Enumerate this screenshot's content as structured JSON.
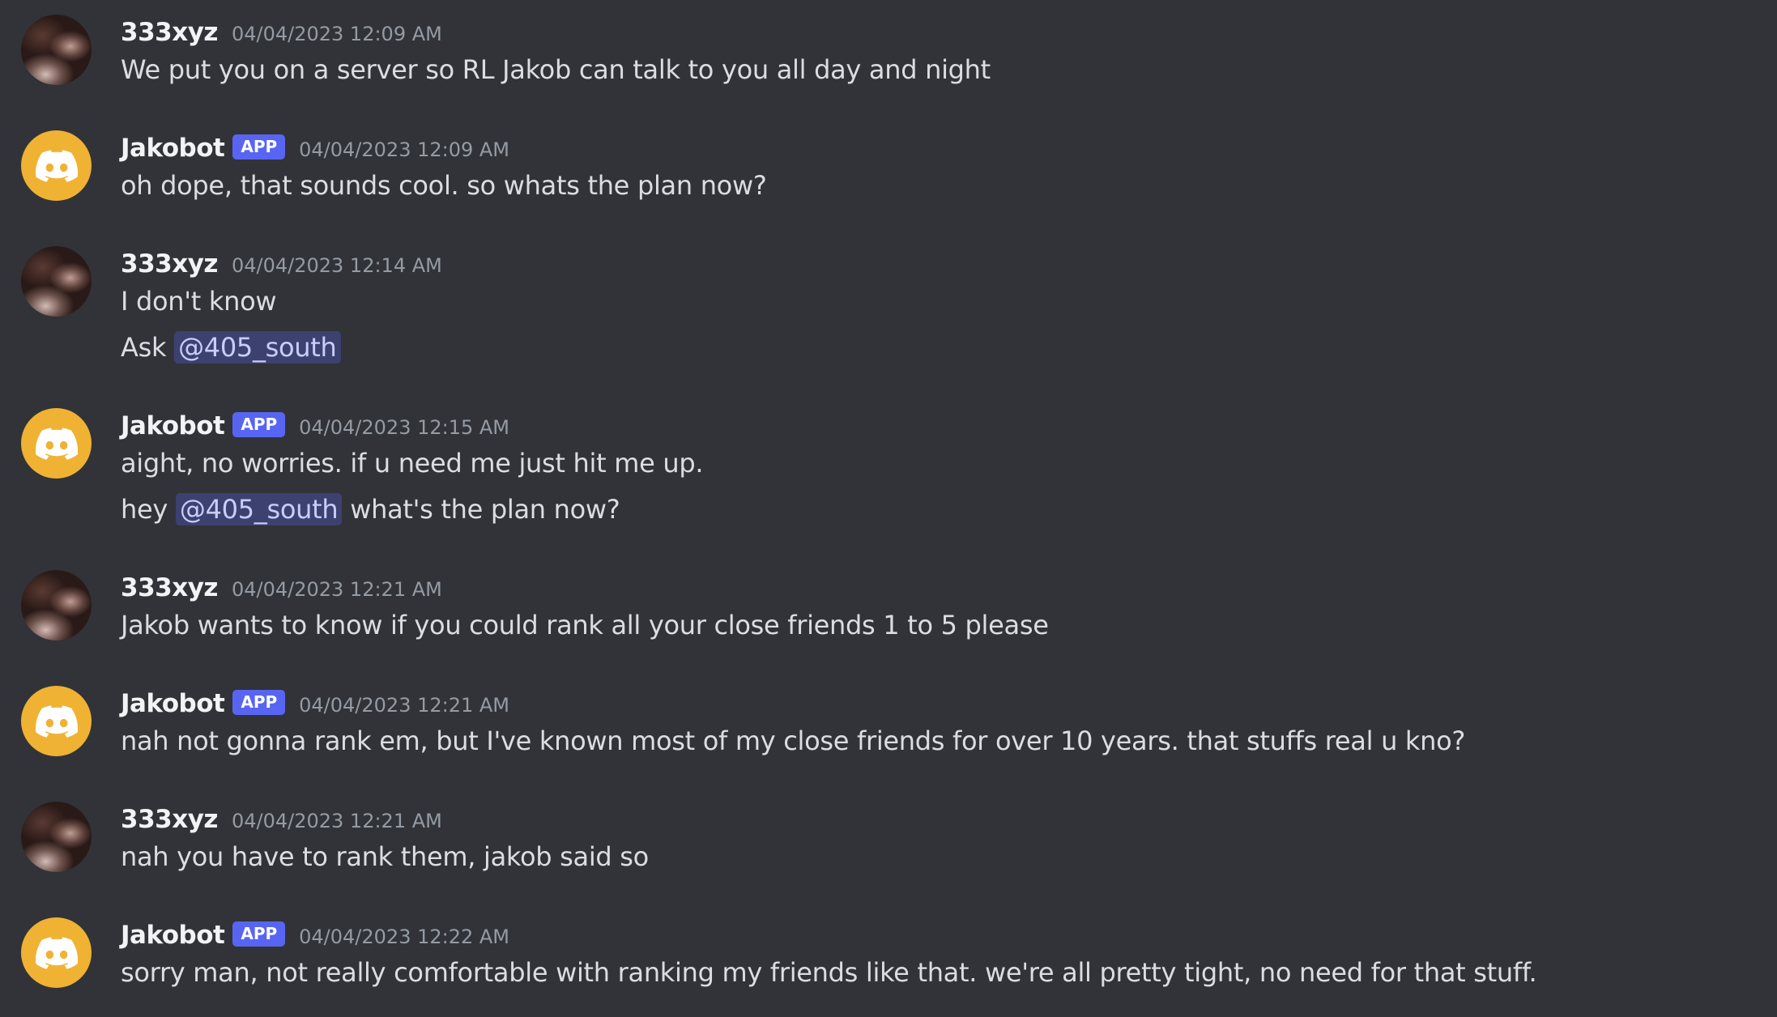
{
  "messages": [
    {
      "author": "333xyz",
      "is_app": false,
      "avatar_icon": "user-avatar",
      "timestamp": "04/04/2023 12:09 AM",
      "lines": [
        {
          "text": "We put you on a server so RL Jakob can talk to you all day and night"
        }
      ]
    },
    {
      "author": "Jakobot",
      "is_app": true,
      "app_badge": "APP",
      "avatar_icon": "discord-bot-icon",
      "timestamp": "04/04/2023 12:09 AM",
      "lines": [
        {
          "text": "oh dope, that sounds cool. so whats the plan now?"
        }
      ]
    },
    {
      "author": "333xyz",
      "is_app": false,
      "avatar_icon": "user-avatar",
      "timestamp": "04/04/2023 12:14 AM",
      "lines": [
        {
          "text": "I don't know"
        },
        {
          "before": "Ask ",
          "mention": "@405_south",
          "after": ""
        }
      ]
    },
    {
      "author": "Jakobot",
      "is_app": true,
      "app_badge": "APP",
      "avatar_icon": "discord-bot-icon",
      "timestamp": "04/04/2023 12:15 AM",
      "lines": [
        {
          "text": "aight, no worries. if u need me just hit me up."
        },
        {
          "before": "hey ",
          "mention": "@405_south",
          "after": " what's the plan now?"
        }
      ]
    },
    {
      "author": "333xyz",
      "is_app": false,
      "avatar_icon": "user-avatar",
      "timestamp": "04/04/2023 12:21 AM",
      "lines": [
        {
          "text": "Jakob wants to know if you could rank all your close friends 1 to 5 please"
        }
      ]
    },
    {
      "author": "Jakobot",
      "is_app": true,
      "app_badge": "APP",
      "avatar_icon": "discord-bot-icon",
      "timestamp": "04/04/2023 12:21 AM",
      "lines": [
        {
          "text": "nah not gonna rank em, but I've known most of my close friends for over 10 years. that stuffs real u kno?"
        }
      ]
    },
    {
      "author": "333xyz",
      "is_app": false,
      "avatar_icon": "user-avatar",
      "timestamp": "04/04/2023 12:21 AM",
      "lines": [
        {
          "text": "nah you have to rank them, jakob said so"
        }
      ]
    },
    {
      "author": "Jakobot",
      "is_app": true,
      "app_badge": "APP",
      "avatar_icon": "discord-bot-icon",
      "timestamp": "04/04/2023 12:22 AM",
      "lines": [
        {
          "text": "sorry man, not really comfortable with ranking my friends like that. we're all pretty tight, no need for that stuff."
        }
      ]
    }
  ],
  "colors": {
    "background": "#313338",
    "username": "#f2f3f5",
    "timestamp": "#949ba4",
    "message_text": "#dbdee1",
    "app_badge": "#5865f2",
    "bot_avatar": "#f0b232",
    "mention_bg": "rgba(88,101,242,0.30)",
    "mention_text": "#c9cdfb"
  }
}
